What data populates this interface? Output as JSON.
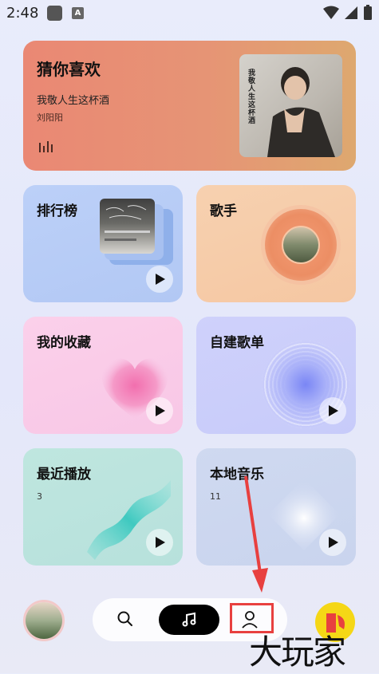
{
  "status": {
    "time": "2:48",
    "notif_icon": "a-icon"
  },
  "hero": {
    "title": "猜你喜欢",
    "song": "我敬人生这杯酒",
    "artist": "刘阳阳",
    "album_text": "我敬人生这杯酒"
  },
  "cards": {
    "ranking": {
      "title": "排行榜"
    },
    "singer": {
      "title": "歌手"
    },
    "favorites": {
      "title": "我的收藏"
    },
    "custom": {
      "title": "自建歌单"
    },
    "recent": {
      "title": "最近播放",
      "count": "3"
    },
    "local": {
      "title": "本地音乐",
      "count": "11"
    }
  },
  "nav": {
    "items": [
      "search-icon",
      "music-note-icon",
      "user-icon"
    ]
  },
  "watermark": "大玩家",
  "colors": {
    "hero": "#e8907a",
    "ranking": "#b6cbf5",
    "singer": "#f6caa6",
    "favorites": "#f9cbe7",
    "custom": "#cbcefb",
    "recent": "#bbe3dd",
    "local": "#ccd6ef",
    "annotation": "#e8403f"
  }
}
